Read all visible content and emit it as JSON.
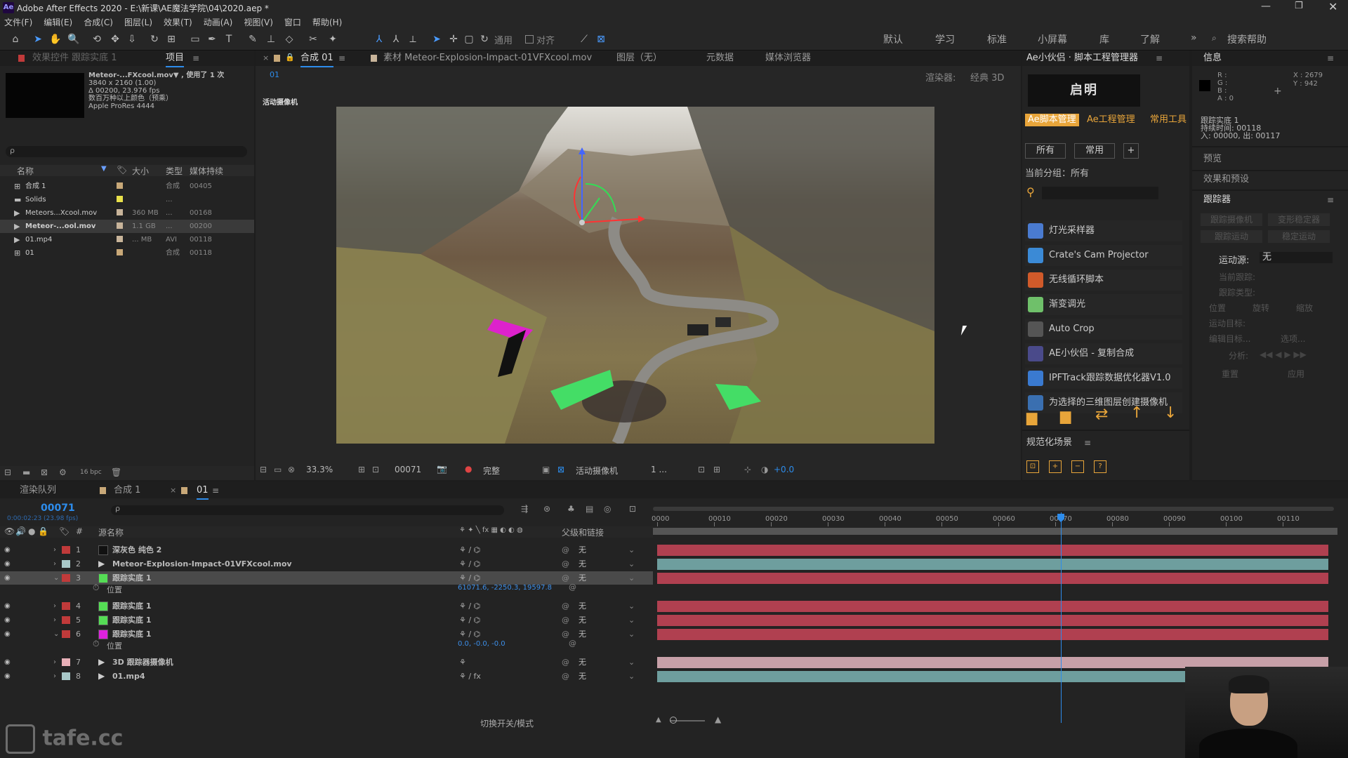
{
  "window": {
    "title": "Adobe After Effects 2020 - E:\\新课\\AE魔法学院\\04\\2020.aep *"
  },
  "menu": [
    "文件(F)",
    "编辑(E)",
    "合成(C)",
    "图层(L)",
    "效果(T)",
    "动画(A)",
    "视图(V)",
    "窗口",
    "帮助(H)"
  ],
  "toolbar": {
    "snap_label": "通用",
    "align_label": "对齐",
    "search_help": "搜索帮助"
  },
  "workspaces": [
    "默认",
    "学习",
    "标准",
    "小屏幕",
    "库",
    "了解"
  ],
  "project_panel": {
    "tab_effects": "效果控件 跟踪实底 1",
    "tab_project": "项目",
    "thumb_info": [
      "Meteor-...FXcool.mov▼ , 使用了 1 次",
      "3840 x 2160 (1.00)",
      "Δ 00200, 23.976 fps",
      "数百万种以上颜色（预乘）",
      "Apple ProRes 4444"
    ],
    "search_placeholder": "ρ",
    "columns": [
      "名称",
      "大小",
      "类型",
      "媒体持续"
    ],
    "items": [
      {
        "name": "合成 1",
        "size": "",
        "type": "合成",
        "dur": "00405",
        "color": "#c8a878"
      },
      {
        "name": "Solids",
        "size": "",
        "type": "...",
        "dur": "",
        "color": "#e8e04a"
      },
      {
        "name": "Meteors...Xcool.mov",
        "size": "360 MB",
        "type": "...",
        "dur": "00168",
        "color": "#c8b49a"
      },
      {
        "name": "Meteor-...ool.mov",
        "size": "1.1 GB",
        "type": "...",
        "dur": "00200",
        "color": "#c8b49a"
      },
      {
        "name": "01.mp4",
        "size": "... MB",
        "type": "AVI",
        "dur": "00118",
        "color": "#c8b49a"
      },
      {
        "name": "01",
        "size": "",
        "type": "合成",
        "dur": "00118",
        "color": "#c8a878"
      }
    ],
    "bpc": "16 bpc"
  },
  "viewer": {
    "tab_comp": "合成 01",
    "tab_footage": "素材 Meteor-Explosion-Impact-01VFXcool.mov",
    "tab_layer": "图层（无）",
    "tab_meta": "元数据",
    "tab_media": "媒体浏览器",
    "breadcrumb": "01",
    "renderer": "渲染器:",
    "renderer_val": "经典 3D",
    "camera_label": "活动摄像机",
    "zoom": "33.3%",
    "frame": "00071",
    "quality": "完整",
    "view_camera": "活动摄像机",
    "views": "1 ...",
    "exposure": "+0.0"
  },
  "script_panel": {
    "title": "Ae小伙侣 · 脚本工程管理器",
    "logo_text": "启明",
    "tabs": [
      "Ae脚本管理",
      "Ae工程管理",
      "常用工具"
    ],
    "filters": [
      "所有",
      "常用",
      "+"
    ],
    "current_group": "当前分组：所有",
    "plugins": [
      {
        "name": "灯光采样器",
        "color": "#4a7bd0"
      },
      {
        "name": "Crate's Cam Projector",
        "color": "#3b8ad6"
      },
      {
        "name": "无线循环脚本",
        "color": "#d05a2a"
      },
      {
        "name": "渐变调光",
        "color": "#6fc06a"
      },
      {
        "name": "Auto Crop",
        "color": "#555555"
      },
      {
        "name": "AE小伙侣 - 复制合成",
        "color": "#4a4a8a"
      },
      {
        "name": "IPFTrack跟踪数据优化器V1.0",
        "color": "#3a7ad0"
      },
      {
        "name": "为选择的三维图层创建摄像机",
        "color": "#3a6fb0"
      }
    ],
    "section2": "规范化场景"
  },
  "info_panel": {
    "title": "信息",
    "rgba": [
      "R :",
      "G :",
      "B :",
      "A : 0"
    ],
    "coords": [
      "X : 2679",
      "Y : 942"
    ],
    "layer_info": [
      "跟踪实底 1",
      "持续时间: 00118",
      "入: 00000, 出: 00117"
    ],
    "preview": "预览",
    "effects": "效果和预设",
    "tracker": "跟踪器",
    "tracker_btns": [
      "跟踪摄像机",
      "变形稳定器",
      "跟踪运动",
      "稳定运动"
    ],
    "motion_source": "运动源:",
    "motion_source_val": "无",
    "current_track": "当前跟踪:",
    "track_type": "跟踪类型:",
    "checks": [
      "位置",
      "旋转",
      "缩放"
    ],
    "motion_target": "运动目标:",
    "edit_target": "编辑目标...",
    "options": "选项...",
    "analyze": "分析:",
    "reset": "重置",
    "apply": "应用"
  },
  "timeline": {
    "tab_render": "渲染队列",
    "tab_comp1": "合成 1",
    "tab_01": "01",
    "timecode": "00071",
    "timecode_sub": "0:00:02:23 (23.98 fps)",
    "col_source": "源名称",
    "col_parent": "父级和链接",
    "ruler": [
      "0000",
      "00010",
      "00020",
      "00030",
      "00040",
      "00050",
      "00060",
      "00070",
      "00080",
      "00090",
      "00100",
      "00110"
    ],
    "playhead_frame": 71,
    "total_frames": 118,
    "layers": [
      {
        "num": "1",
        "name": "深灰色 纯色 2",
        "color": "#c03a3a",
        "swatch": "#111111",
        "parent": "无",
        "bar": "#b04050"
      },
      {
        "num": "2",
        "name": "Meteor-Explosion-Impact-01VFXcool.mov",
        "color": "#a8c8c8",
        "swatch": "",
        "parent": "无",
        "bar": "#6e9e9e"
      },
      {
        "num": "3",
        "name": "跟踪实底 1",
        "color": "#c03a3a",
        "swatch": "#55dd55",
        "parent": "无",
        "bar": "#b04050",
        "selected": true
      },
      {
        "num": "4",
        "name": "跟踪实底 1",
        "color": "#c03a3a",
        "swatch": "#55dd55",
        "parent": "无",
        "bar": "#b04050"
      },
      {
        "num": "5",
        "name": "跟踪实底 1",
        "color": "#c03a3a",
        "swatch": "#55dd55",
        "parent": "无",
        "bar": "#b04050"
      },
      {
        "num": "6",
        "name": "跟踪实底 1",
        "color": "#c03a3a",
        "swatch": "#dd22dd",
        "parent": "无",
        "bar": "#b04050"
      },
      {
        "num": "7",
        "name": "3D 跟踪器摄像机",
        "color": "#e8b0b8",
        "swatch": "",
        "parent": "无",
        "bar": "#c7a0a8"
      },
      {
        "num": "8",
        "name": "01.mp4",
        "color": "#a8c8c8",
        "swatch": "",
        "parent": "无",
        "bar": "#6e9e9e"
      }
    ],
    "prop_label": "位置",
    "prop3_value": "61071.6, -2250.3, 19597.8",
    "prop6_value": "0.0, -0.0, -0.0",
    "toggle_modes": "切换开关/模式"
  },
  "watermark": "tafe.cc"
}
